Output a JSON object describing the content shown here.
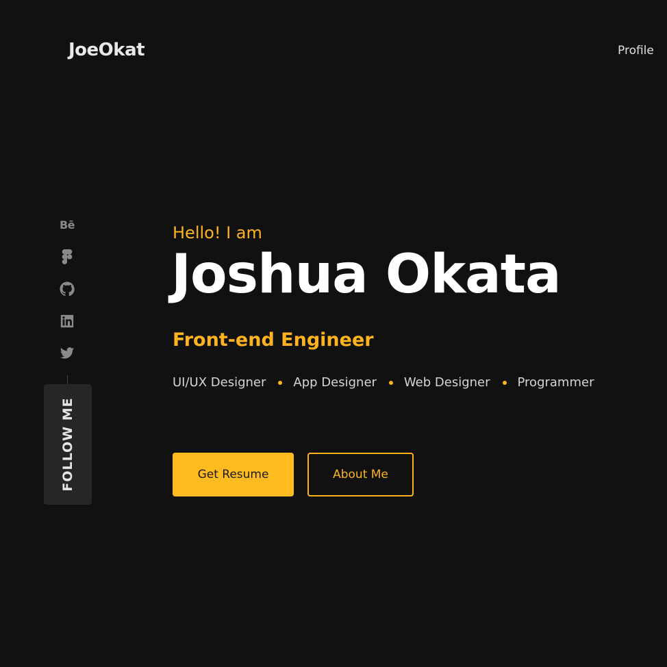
{
  "header": {
    "logo": "JoeOkat",
    "nav": [
      "Profile"
    ]
  },
  "social": {
    "icons": [
      "behance-icon",
      "figma-icon",
      "github-icon",
      "linkedin-icon",
      "twitter-icon"
    ],
    "behance_label": "Bē",
    "follow_label": "FOLLOW ME"
  },
  "hero": {
    "greeting": "Hello! I am",
    "name": "Joshua Okata",
    "role": "Front-end Engineer",
    "skills": [
      "UI/UX Designer",
      "App Designer",
      "Web Designer",
      "Programmer"
    ]
  },
  "buttons": {
    "resume": "Get Resume",
    "about": "About Me"
  },
  "colors": {
    "background": "#111111",
    "accent": "#ffb41f",
    "text": "#ffffff",
    "muted": "#8a8a8a"
  }
}
